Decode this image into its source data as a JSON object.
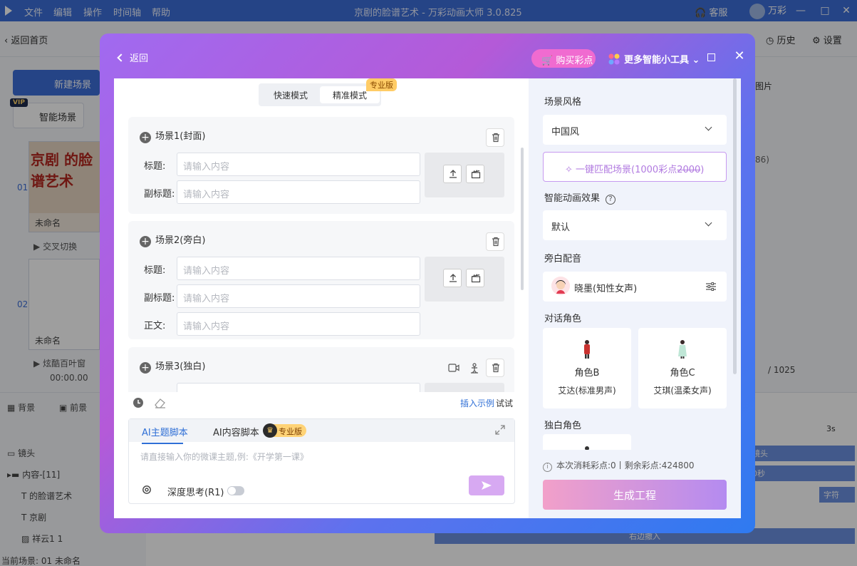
{
  "app": {
    "menu": [
      "文件",
      "编辑",
      "操作",
      "时间轴",
      "帮助"
    ],
    "window_title": "京剧的脸谱艺术 - 万彩动画大师 3.0.825",
    "support": "客服",
    "user_name": "万彩",
    "back_home": "返回首页",
    "history": "历史",
    "settings": "设置",
    "new_scene": "新建场景",
    "smart_scene": "智能场景",
    "vip": "VIP",
    "scenes": [
      {
        "num": "01",
        "name": "未命名",
        "transition": "交叉切换",
        "thumb_text": "京剧  的脸谱艺术"
      },
      {
        "num": "02",
        "name": "未命名",
        "transition": "炫酷百叶窗",
        "time": "00:00.00"
      }
    ],
    "bg_tab": "背景",
    "fg_tab": "前景",
    "layers": [
      "镜头",
      "内容-[11]",
      "的脸谱艺术",
      "京剧",
      "祥云1 1"
    ],
    "status": "当前场景: 01   未命名",
    "right_panel": {
      "tab": "图片",
      "count": "86)",
      "page": "/ 1025"
    },
    "timeline": {
      "time_label": "3s",
      "tracks": [
        "镜头",
        "0秒",
        "字符",
        "右边撤入"
      ]
    }
  },
  "modal": {
    "back": "返回",
    "buy_points": "购买彩点",
    "more_tools": "更多智能小工具",
    "mode_fast": "快速模式",
    "mode_precise": "精准模式",
    "pro_badge": "专业版",
    "scenes": [
      {
        "title": "场景1(封面)",
        "fields": [
          {
            "label": "标题:",
            "placeholder": "请输入内容"
          },
          {
            "label": "副标题:",
            "placeholder": "请输入内容"
          }
        ]
      },
      {
        "title": "场景2(旁白)",
        "fields": [
          {
            "label": "标题:",
            "placeholder": "请输入内容"
          },
          {
            "label": "副标题:",
            "placeholder": "请输入内容"
          },
          {
            "label": "正文:",
            "placeholder": "请输入内容"
          }
        ]
      },
      {
        "title": "场景3(独白)"
      }
    ],
    "insert_sample": "插入示例",
    "try": "试试",
    "ai_tab_theme": "AI主题脚本",
    "ai_tab_content": "AI内容脚本",
    "ai_pro": "专业版",
    "ai_placeholder": "请直接输入你的微课主题,例:《开学第一课》",
    "deep_think": "深度思考(R1)",
    "style_label": "场景风格",
    "style_value": "中国风",
    "match_prefix": "一键匹配场景(1000彩点",
    "match_strike": "2000",
    "match_suffix": ")",
    "anim_label": "智能动画效果",
    "anim_value": "默认",
    "voice_label": "旁白配音",
    "voice_value": "晓墨(知性女声)",
    "dialog_label": "对话角色",
    "roles": [
      {
        "name": "角色B",
        "voice": "艾达(标准男声)"
      },
      {
        "name": "角色C",
        "voice": "艾琪(温柔女声)"
      }
    ],
    "solo_label": "独白角色",
    "cost": "本次消耗彩点:0丨剩余彩点:424800",
    "generate": "生成工程"
  }
}
